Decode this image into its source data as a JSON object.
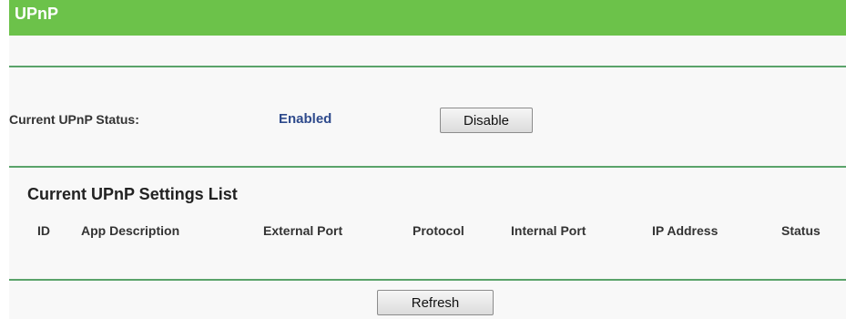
{
  "header": {
    "title": "UPnP"
  },
  "status": {
    "label": "Current UPnP Status:",
    "value": "Enabled",
    "value_color": "#2e4a8c",
    "toggle_button_label": "Disable"
  },
  "settings_list": {
    "title": "Current UPnP Settings List",
    "columns": [
      "ID",
      "App Description",
      "External Port",
      "Protocol",
      "Internal Port",
      "IP Address",
      "Status"
    ],
    "rows": []
  },
  "footer": {
    "refresh_label": "Refresh"
  },
  "colors": {
    "accent": "#6cc24a",
    "divider": "#5aa36a",
    "panel_background": "#f8f8f8"
  }
}
